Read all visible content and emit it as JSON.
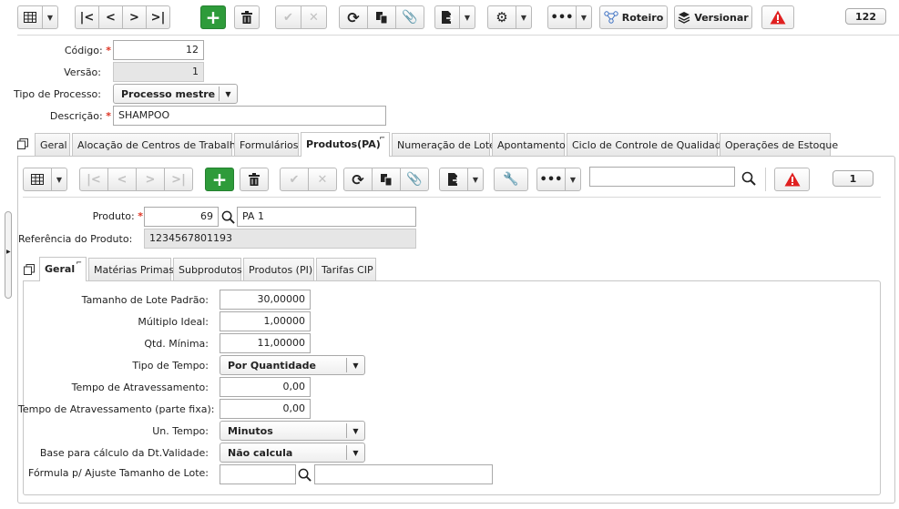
{
  "toolbar": {
    "roteiro_label": "Roteiro",
    "versionar_label": "Versionar",
    "record_count": "122"
  },
  "header_form": {
    "codigo_label": "Código:",
    "codigo_value": "12",
    "versao_label": "Versão:",
    "versao_value": "1",
    "tipo_processo_label": "Tipo de Processo:",
    "tipo_processo_value": "Processo mestre",
    "descricao_label": "Descrição:",
    "descricao_value": "SHAMPOO",
    "required_mark": "*"
  },
  "main_tabs": [
    {
      "label": "Geral"
    },
    {
      "label": "Alocação de Centros de Trabalho"
    },
    {
      "label": "Formulários"
    },
    {
      "label": "Produtos(PA)"
    },
    {
      "label": "Numeração de Lote"
    },
    {
      "label": "Apontamento"
    },
    {
      "label": "Ciclo de Controle de Qualidade"
    },
    {
      "label": "Operações de Estoque"
    }
  ],
  "sub_toolbar": {
    "search_value": "",
    "record_count": "1"
  },
  "product_form": {
    "produto_label": "Produto:",
    "produto_code": "69",
    "produto_name": "PA 1",
    "referencia_label": "Referência do Produto:",
    "referencia_value": "1234567801193"
  },
  "sub_tabs": [
    {
      "label": "Geral"
    },
    {
      "label": "Matérias Primas"
    },
    {
      "label": "Subprodutos"
    },
    {
      "label": "Produtos (PI)"
    },
    {
      "label": "Tarifas CIP"
    }
  ],
  "geral_form": {
    "tamanho_lote_label": "Tamanho de Lote Padrão:",
    "tamanho_lote_value": "30,00000",
    "multiplo_label": "Múltiplo Ideal:",
    "multiplo_value": "1,00000",
    "qtd_minima_label": "Qtd. Mínima:",
    "qtd_minima_value": "11,00000",
    "tipo_tempo_label": "Tipo de Tempo:",
    "tipo_tempo_value": "Por Quantidade",
    "tempo_atrav_label": "Tempo de Atravessamento:",
    "tempo_atrav_value": "0,00",
    "tempo_atrav_fixa_label": "Tempo de Atravessamento (parte fixa):",
    "tempo_atrav_fixa_value": "0,00",
    "un_tempo_label": "Un. Tempo:",
    "un_tempo_value": "Minutos",
    "base_calculo_label": "Base para cálculo da Dt.Validade:",
    "base_calculo_value": "Não calcula",
    "formula_label": "Fórmula p/ Ajuste Tamanho de Lote:",
    "formula_code": "",
    "formula_name": ""
  },
  "colors": {
    "green": "#2e9b3a",
    "red": "#e02020",
    "required": "#dd3322"
  }
}
